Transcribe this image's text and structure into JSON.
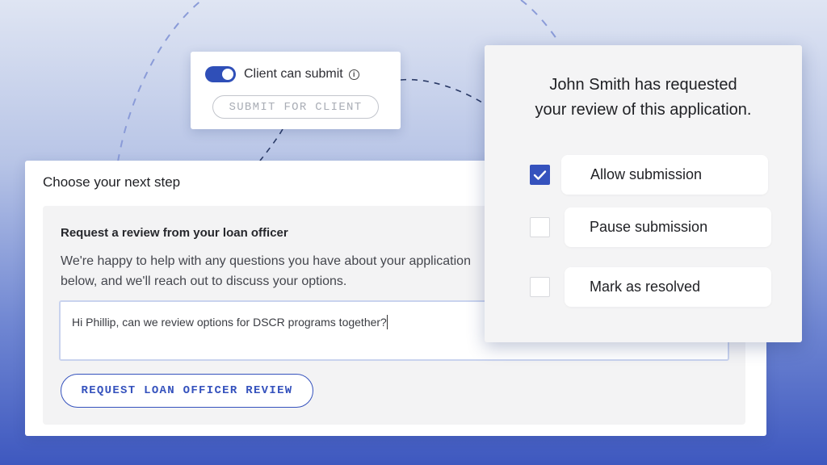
{
  "toggle_card": {
    "toggle_label": "Client can submit",
    "toggle_on": true,
    "info_icon": "i",
    "submit_button_label": "SUBMIT FOR CLIENT"
  },
  "main_card": {
    "title": "Choose your next step",
    "panel_heading": "Request a review from your loan officer",
    "panel_body_line1": "We're happy to help with any questions you have about your application",
    "panel_body_line2": "below, and we'll reach out to discuss your options.",
    "message_value": "Hi Phillip, can we review options for DSCR programs together?",
    "request_button_label": "REQUEST LOAN OFFICER REVIEW"
  },
  "review_card": {
    "title_line1": "John Smith has requested",
    "title_line2": "your review of this application.",
    "options": [
      {
        "label": "Allow submission",
        "checked": true
      },
      {
        "label": "Pause submission",
        "checked": false
      },
      {
        "label": "Mark as resolved",
        "checked": false
      }
    ]
  },
  "colors": {
    "accent": "#3552bd",
    "background_top": "#dfe5f3",
    "background_bottom": "#3e58bf"
  }
}
